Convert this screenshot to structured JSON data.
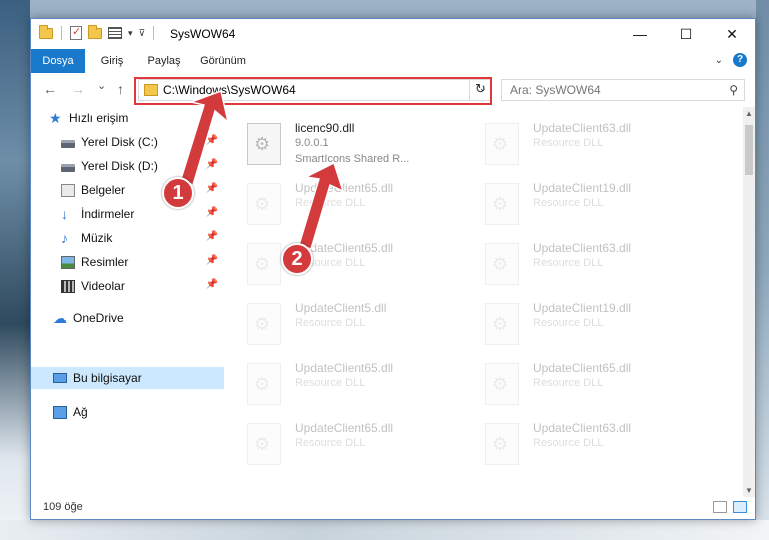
{
  "window": {
    "title": "SysWOW64",
    "controls": {
      "minimize": "—",
      "maximize": "☐",
      "close": "✕"
    }
  },
  "ribbon": {
    "tabs": [
      "Dosya",
      "Giriş",
      "Paylaş",
      "Görünüm"
    ],
    "active_tab": "Dosya",
    "help": "?"
  },
  "nav": {
    "back": "←",
    "forward": "→",
    "recent": "⌄",
    "up": "↑",
    "address": "C:\\Windows\\SysWOW64",
    "refresh": "↻",
    "search_placeholder": "Ara: SysWOW64"
  },
  "sidebar": {
    "items": [
      {
        "label": "Hızlı erişim",
        "icon": "star-icon",
        "pinned": false
      },
      {
        "label": "Yerel Disk (C:)",
        "icon": "disk-icon",
        "pinned": true
      },
      {
        "label": "Yerel Disk (D:)",
        "icon": "disk-icon",
        "pinned": true
      },
      {
        "label": "Belgeler",
        "icon": "documents-icon",
        "pinned": true
      },
      {
        "label": "İndirmeler",
        "icon": "downloads-icon",
        "pinned": true
      },
      {
        "label": "Müzik",
        "icon": "music-icon",
        "pinned": true
      },
      {
        "label": "Resimler",
        "icon": "pictures-icon",
        "pinned": true
      },
      {
        "label": "Videolar",
        "icon": "videos-icon",
        "pinned": true
      },
      {
        "label": "OneDrive",
        "icon": "onedrive-icon",
        "pinned": false
      },
      {
        "label": "Bu bilgisayar",
        "icon": "this-pc-icon",
        "pinned": false,
        "selected": true
      },
      {
        "label": "Ağ",
        "icon": "network-icon",
        "pinned": false
      }
    ]
  },
  "files": [
    {
      "name": "licenc90.dll",
      "line2": "9.0.0.1",
      "line3": "SmartIcons Shared R...",
      "faded": false
    },
    {
      "name": "UpdateClient63.dll",
      "line2": "Resource DLL",
      "faded": true
    },
    {
      "name": "UpdateClient65.dll",
      "line2": "Resource DLL",
      "faded": true
    },
    {
      "name": "UpdateClient19.dll",
      "line2": "Resource DLL",
      "faded": true
    },
    {
      "name": "UpdateClient65.dll",
      "line2": "Resource DLL",
      "faded": true
    },
    {
      "name": "UpdateClient63.dll",
      "line2": "Resource DLL",
      "faded": true
    },
    {
      "name": "UpdateClient5.dll",
      "line2": "Resource DLL",
      "faded": true
    },
    {
      "name": "UpdateClient19.dll",
      "line2": "Resource DLL",
      "faded": true
    },
    {
      "name": "UpdateClient65.dll",
      "line2": "Resource DLL",
      "faded": true
    },
    {
      "name": "UpdateClient65.dll",
      "line2": "Resource DLL",
      "faded": true
    },
    {
      "name": "UpdateClient65.dll",
      "line2": "Resource DLL",
      "faded": true
    },
    {
      "name": "UpdateClient63.dll",
      "line2": "Resource DLL",
      "faded": true
    }
  ],
  "status": {
    "count": "109 öğe"
  },
  "annotations": {
    "badge1": "1",
    "badge2": "2",
    "color": "#d23a3c"
  }
}
